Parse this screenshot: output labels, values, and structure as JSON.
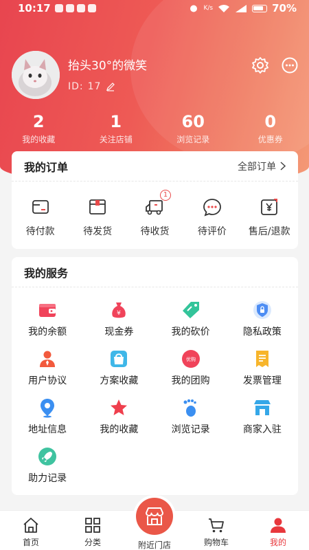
{
  "status_bar": {
    "time": "10:17",
    "network_speed": "K/s",
    "battery": "70%"
  },
  "profile": {
    "name": "抬头30°的微笑",
    "id_label": "ID:",
    "id_value": "17"
  },
  "stats": [
    {
      "value": "2",
      "label": "我的收藏"
    },
    {
      "value": "1",
      "label": "关注店铺"
    },
    {
      "value": "60",
      "label": "浏览记录"
    },
    {
      "value": "0",
      "label": "优惠券"
    }
  ],
  "orders": {
    "title": "我的订单",
    "all_link": "全部订单",
    "items": [
      {
        "label": "待付款",
        "icon": "wallet-card-icon"
      },
      {
        "label": "待发货",
        "icon": "package-box-icon"
      },
      {
        "label": "待收货",
        "icon": "delivery-truck-icon",
        "badge": "1"
      },
      {
        "label": "待评价",
        "icon": "chat-bubble-icon"
      },
      {
        "label": "售后/退款",
        "icon": "refund-yen-icon"
      }
    ]
  },
  "services": {
    "title": "我的服务",
    "items": [
      {
        "label": "我的余额",
        "icon": "wallet-icon",
        "color": "#f0435a"
      },
      {
        "label": "现金券",
        "icon": "money-bag-icon",
        "color": "#f0435a"
      },
      {
        "label": "我的砍价",
        "icon": "price-tag-icon",
        "color": "#33c49a"
      },
      {
        "label": "隐私政策",
        "icon": "privacy-shield-icon",
        "color": "#4d8df3"
      },
      {
        "label": "用户协议",
        "icon": "user-agreement-icon",
        "color": "#f25a3d"
      },
      {
        "label": "方案收藏",
        "icon": "shopping-bag-icon",
        "color": "#3fb7e8"
      },
      {
        "label": "我的团购",
        "icon": "group-buy-icon",
        "color": "#f0435a"
      },
      {
        "label": "发票管理",
        "icon": "invoice-icon",
        "color": "#f7b52b"
      },
      {
        "label": "地址信息",
        "icon": "location-pin-icon",
        "color": "#3b8ff1"
      },
      {
        "label": "我的收藏",
        "icon": "star-icon",
        "color": "#ef3f4d"
      },
      {
        "label": "浏览记录",
        "icon": "footprint-icon",
        "color": "#3b8ff1"
      },
      {
        "label": "商家入驻",
        "icon": "storefront-icon",
        "color": "#35a7e8"
      },
      {
        "label": "助力记录",
        "icon": "rocket-icon",
        "color": "#3fc3a0"
      }
    ],
    "group_buy_text": "优购"
  },
  "bottom_nav": [
    {
      "label": "首页",
      "icon": "home-icon"
    },
    {
      "label": "分类",
      "icon": "grid-category-icon"
    },
    {
      "label": "附近门店",
      "icon": "nearby-store-icon"
    },
    {
      "label": "购物车",
      "icon": "cart-icon"
    },
    {
      "label": "我的",
      "icon": "profile-icon",
      "active": true
    }
  ]
}
